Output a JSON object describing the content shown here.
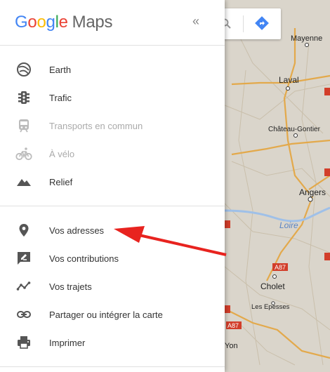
{
  "header": {
    "logo_google": "Google",
    "logo_maps": "Maps",
    "collapse_label": "«"
  },
  "layers": [
    {
      "label": "Earth",
      "icon": "earth-icon",
      "disabled": false
    },
    {
      "label": "Trafic",
      "icon": "traffic-light-icon",
      "disabled": false
    },
    {
      "label": "Transports en commun",
      "icon": "train-icon",
      "disabled": true
    },
    {
      "label": "À vélo",
      "icon": "bicycle-icon",
      "disabled": true
    },
    {
      "label": "Relief",
      "icon": "terrain-icon",
      "disabled": false
    }
  ],
  "actions": [
    {
      "label": "Vos adresses",
      "icon": "pin-icon"
    },
    {
      "label": "Vos contributions",
      "icon": "contribution-icon"
    },
    {
      "label": "Vos trajets",
      "icon": "timeline-icon"
    },
    {
      "label": "Partager ou intégrer la carte",
      "icon": "link-icon"
    },
    {
      "label": "Imprimer",
      "icon": "printer-icon"
    }
  ],
  "map": {
    "cities": [
      "Mayenne",
      "Laval",
      "Château-Gontier",
      "Angers",
      "Cholet",
      "Les Epesses",
      "Yon"
    ],
    "river": "Loire",
    "roads": [
      "A87",
      "A87"
    ]
  },
  "colors": {
    "arrow": "#e8231f",
    "direction_button": "#4285f4"
  }
}
